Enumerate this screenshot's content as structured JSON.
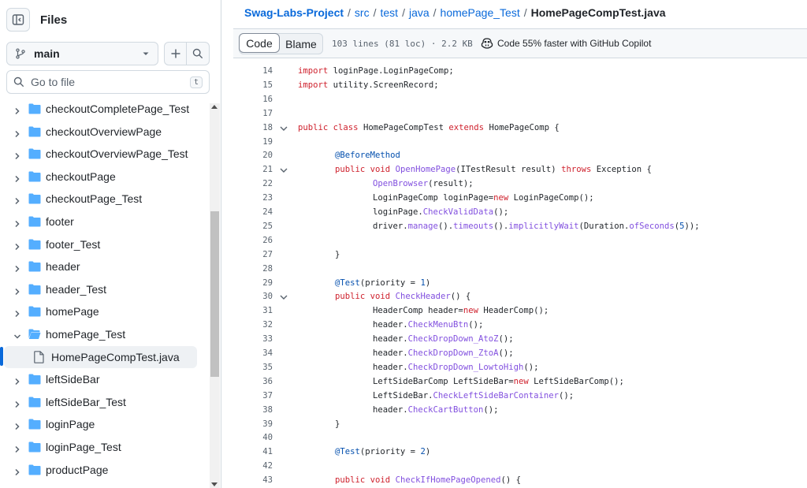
{
  "sidebar": {
    "title": "Files",
    "branch": "main",
    "goto_placeholder": "Go to file",
    "goto_shortcut": "t",
    "items": [
      {
        "name": "checkoutCompletePage_Test",
        "type": "folder",
        "expanded": false
      },
      {
        "name": "checkoutOverviewPage",
        "type": "folder",
        "expanded": false
      },
      {
        "name": "checkoutOverviewPage_Test",
        "type": "folder",
        "expanded": false
      },
      {
        "name": "checkoutPage",
        "type": "folder",
        "expanded": false
      },
      {
        "name": "checkoutPage_Test",
        "type": "folder",
        "expanded": false
      },
      {
        "name": "footer",
        "type": "folder",
        "expanded": false
      },
      {
        "name": "footer_Test",
        "type": "folder",
        "expanded": false
      },
      {
        "name": "header",
        "type": "folder",
        "expanded": false
      },
      {
        "name": "header_Test",
        "type": "folder",
        "expanded": false
      },
      {
        "name": "homePage",
        "type": "folder",
        "expanded": false
      },
      {
        "name": "homePage_Test",
        "type": "folder",
        "expanded": true
      },
      {
        "name": "HomePageCompTest.java",
        "type": "file",
        "selected": true
      },
      {
        "name": "leftSideBar",
        "type": "folder",
        "expanded": false
      },
      {
        "name": "leftSideBar_Test",
        "type": "folder",
        "expanded": false
      },
      {
        "name": "loginPage",
        "type": "folder",
        "expanded": false
      },
      {
        "name": "loginPage_Test",
        "type": "folder",
        "expanded": false
      },
      {
        "name": "productPage",
        "type": "folder",
        "expanded": false
      }
    ]
  },
  "breadcrumb": {
    "repo": "Swag-Labs-Project",
    "parts": [
      "src",
      "test",
      "java",
      "homePage_Test"
    ],
    "current": "HomePageCompTest.java",
    "separator": "/"
  },
  "file_header": {
    "code_label": "Code",
    "blame_label": "Blame",
    "meta": "103 lines (81 loc) · 2.2 KB",
    "copilot": "Code 55% faster with GitHub Copilot"
  },
  "code": {
    "lines": [
      {
        "n": "14",
        "indent": 0,
        "fold": false,
        "tokens": [
          [
            "kw",
            "import"
          ],
          [
            "",
            "loginPage.LoginPageComp;"
          ]
        ]
      },
      {
        "n": "15",
        "indent": 0,
        "fold": false,
        "tokens": [
          [
            "kw",
            "import"
          ],
          [
            "",
            "utility.ScreenRecord;"
          ]
        ]
      },
      {
        "n": "16",
        "indent": 0,
        "fold": false,
        "tokens": []
      },
      {
        "n": "17",
        "indent": 0,
        "fold": false,
        "tokens": []
      },
      {
        "n": "18",
        "indent": 0,
        "fold": true,
        "tokens": [
          [
            "kw",
            "public"
          ],
          [
            "kw",
            "class"
          ],
          [
            "",
            "HomePageCompTest"
          ],
          [
            "kw",
            "extends"
          ],
          [
            "",
            "HomePageComp {"
          ]
        ]
      },
      {
        "n": "19",
        "indent": 0,
        "fold": false,
        "tokens": []
      },
      {
        "n": "20",
        "indent": 1,
        "fold": false,
        "tokens": [
          [
            "an",
            "@BeforeMethod"
          ]
        ]
      },
      {
        "n": "21",
        "indent": 1,
        "fold": true,
        "tokens": [
          [
            "kw",
            "public"
          ],
          [
            "kw",
            "void"
          ],
          [
            "fn",
            "OpenHomePage"
          ],
          [
            "",
            "(ITestResult result)"
          ],
          [
            "kw",
            "throws"
          ],
          [
            "",
            "Exception {"
          ]
        ]
      },
      {
        "n": "22",
        "indent": 2,
        "fold": false,
        "tokens": [
          [
            "fn",
            "OpenBrowser"
          ],
          [
            "",
            "(result);"
          ]
        ]
      },
      {
        "n": "23",
        "indent": 2,
        "fold": false,
        "tokens": [
          [
            "",
            "LoginPageComp loginPage="
          ],
          [
            "kw",
            "new"
          ],
          [
            "",
            "LoginPageComp();"
          ]
        ]
      },
      {
        "n": "24",
        "indent": 2,
        "fold": false,
        "tokens": [
          [
            "",
            "loginPage."
          ],
          [
            "fn",
            "CheckValidData"
          ],
          [
            "",
            "();"
          ]
        ]
      },
      {
        "n": "25",
        "indent": 2,
        "fold": false,
        "tokens": [
          [
            "",
            "driver."
          ],
          [
            "fn",
            "manage"
          ],
          [
            "",
            "()."
          ],
          [
            "fn",
            "timeouts"
          ],
          [
            "",
            "()."
          ],
          [
            "fn",
            "implicitlyWait"
          ],
          [
            "",
            "(Duration."
          ],
          [
            "fn",
            "ofSeconds"
          ],
          [
            "",
            "("
          ],
          [
            "num",
            "5"
          ],
          [
            "",
            "));"
          ]
        ]
      },
      {
        "n": "26",
        "indent": 0,
        "fold": false,
        "tokens": []
      },
      {
        "n": "27",
        "indent": 1,
        "fold": false,
        "tokens": [
          [
            "",
            "}"
          ]
        ]
      },
      {
        "n": "28",
        "indent": 0,
        "fold": false,
        "tokens": []
      },
      {
        "n": "29",
        "indent": 1,
        "fold": false,
        "tokens": [
          [
            "an",
            "@Test"
          ],
          [
            "",
            "(priority = "
          ],
          [
            "num",
            "1"
          ],
          [
            "",
            ")"
          ]
        ]
      },
      {
        "n": "30",
        "indent": 1,
        "fold": true,
        "tokens": [
          [
            "kw",
            "public"
          ],
          [
            "kw",
            "void"
          ],
          [
            "fn",
            "CheckHeader"
          ],
          [
            "",
            "() {"
          ]
        ]
      },
      {
        "n": "31",
        "indent": 2,
        "fold": false,
        "tokens": [
          [
            "",
            "HeaderComp header="
          ],
          [
            "kw",
            "new"
          ],
          [
            "",
            "HeaderComp();"
          ]
        ]
      },
      {
        "n": "32",
        "indent": 2,
        "fold": false,
        "tokens": [
          [
            "",
            "header."
          ],
          [
            "fn",
            "CheckMenuBtn"
          ],
          [
            "",
            "();"
          ]
        ]
      },
      {
        "n": "33",
        "indent": 2,
        "fold": false,
        "tokens": [
          [
            "",
            "header."
          ],
          [
            "fn",
            "CheckDropDown_AtoZ"
          ],
          [
            "",
            "();"
          ]
        ]
      },
      {
        "n": "34",
        "indent": 2,
        "fold": false,
        "tokens": [
          [
            "",
            "header."
          ],
          [
            "fn",
            "CheckDropDown_ZtoA"
          ],
          [
            "",
            "();"
          ]
        ]
      },
      {
        "n": "35",
        "indent": 2,
        "fold": false,
        "tokens": [
          [
            "",
            "header."
          ],
          [
            "fn",
            "CheckDropDown_LowtoHigh"
          ],
          [
            "",
            "();"
          ]
        ]
      },
      {
        "n": "36",
        "indent": 2,
        "fold": false,
        "tokens": [
          [
            "",
            "LeftSideBarComp LeftSideBar="
          ],
          [
            "kw",
            "new"
          ],
          [
            "",
            "LeftSideBarComp();"
          ]
        ]
      },
      {
        "n": "37",
        "indent": 2,
        "fold": false,
        "tokens": [
          [
            "",
            "LeftSideBar."
          ],
          [
            "fn",
            "CheckLeftSideBarContainer"
          ],
          [
            "",
            "();"
          ]
        ]
      },
      {
        "n": "38",
        "indent": 2,
        "fold": false,
        "tokens": [
          [
            "",
            "header."
          ],
          [
            "fn",
            "CheckCartButton"
          ],
          [
            "",
            "();"
          ]
        ]
      },
      {
        "n": "39",
        "indent": 1,
        "fold": false,
        "tokens": [
          [
            "",
            "}"
          ]
        ]
      },
      {
        "n": "40",
        "indent": 0,
        "fold": false,
        "tokens": []
      },
      {
        "n": "41",
        "indent": 1,
        "fold": false,
        "tokens": [
          [
            "an",
            "@Test"
          ],
          [
            "",
            "(priority = "
          ],
          [
            "num",
            "2"
          ],
          [
            "",
            ")"
          ]
        ]
      },
      {
        "n": "42",
        "indent": 0,
        "fold": false,
        "tokens": []
      },
      {
        "n": "43",
        "indent": 1,
        "fold": false,
        "tokens": [
          [
            "kw",
            "public"
          ],
          [
            "kw",
            "void"
          ],
          [
            "fn",
            "CheckIfHomePageOpened"
          ],
          [
            "",
            "() {"
          ]
        ]
      }
    ]
  },
  "colors": {
    "keyword": "#cf222e",
    "function": "#8250df",
    "annotation": "#0550ae",
    "link": "#0969da",
    "folder": "#54aeff"
  }
}
